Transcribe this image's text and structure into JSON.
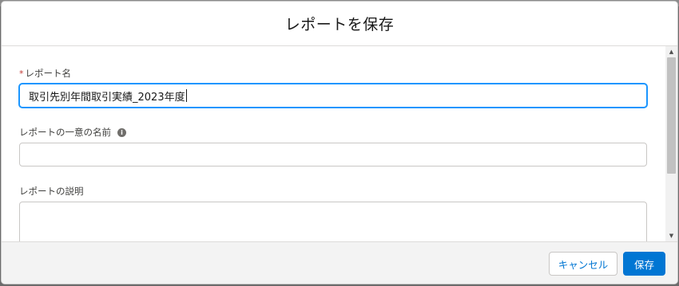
{
  "modal": {
    "title": "レポートを保存"
  },
  "form": {
    "report_name": {
      "required_marker": "*",
      "label": "レポート名",
      "value": "取引先別年間取引実績_2023年度"
    },
    "unique_name": {
      "label": "レポートの一意の名前",
      "info_icon": "info-icon",
      "value": ""
    },
    "description": {
      "label": "レポートの説明",
      "value": ""
    }
  },
  "footer": {
    "cancel_label": "キャンセル",
    "save_label": "保存"
  },
  "colors": {
    "brand": "#0176d3",
    "focus_ring": "#1b96ff",
    "required": "#c23934"
  }
}
